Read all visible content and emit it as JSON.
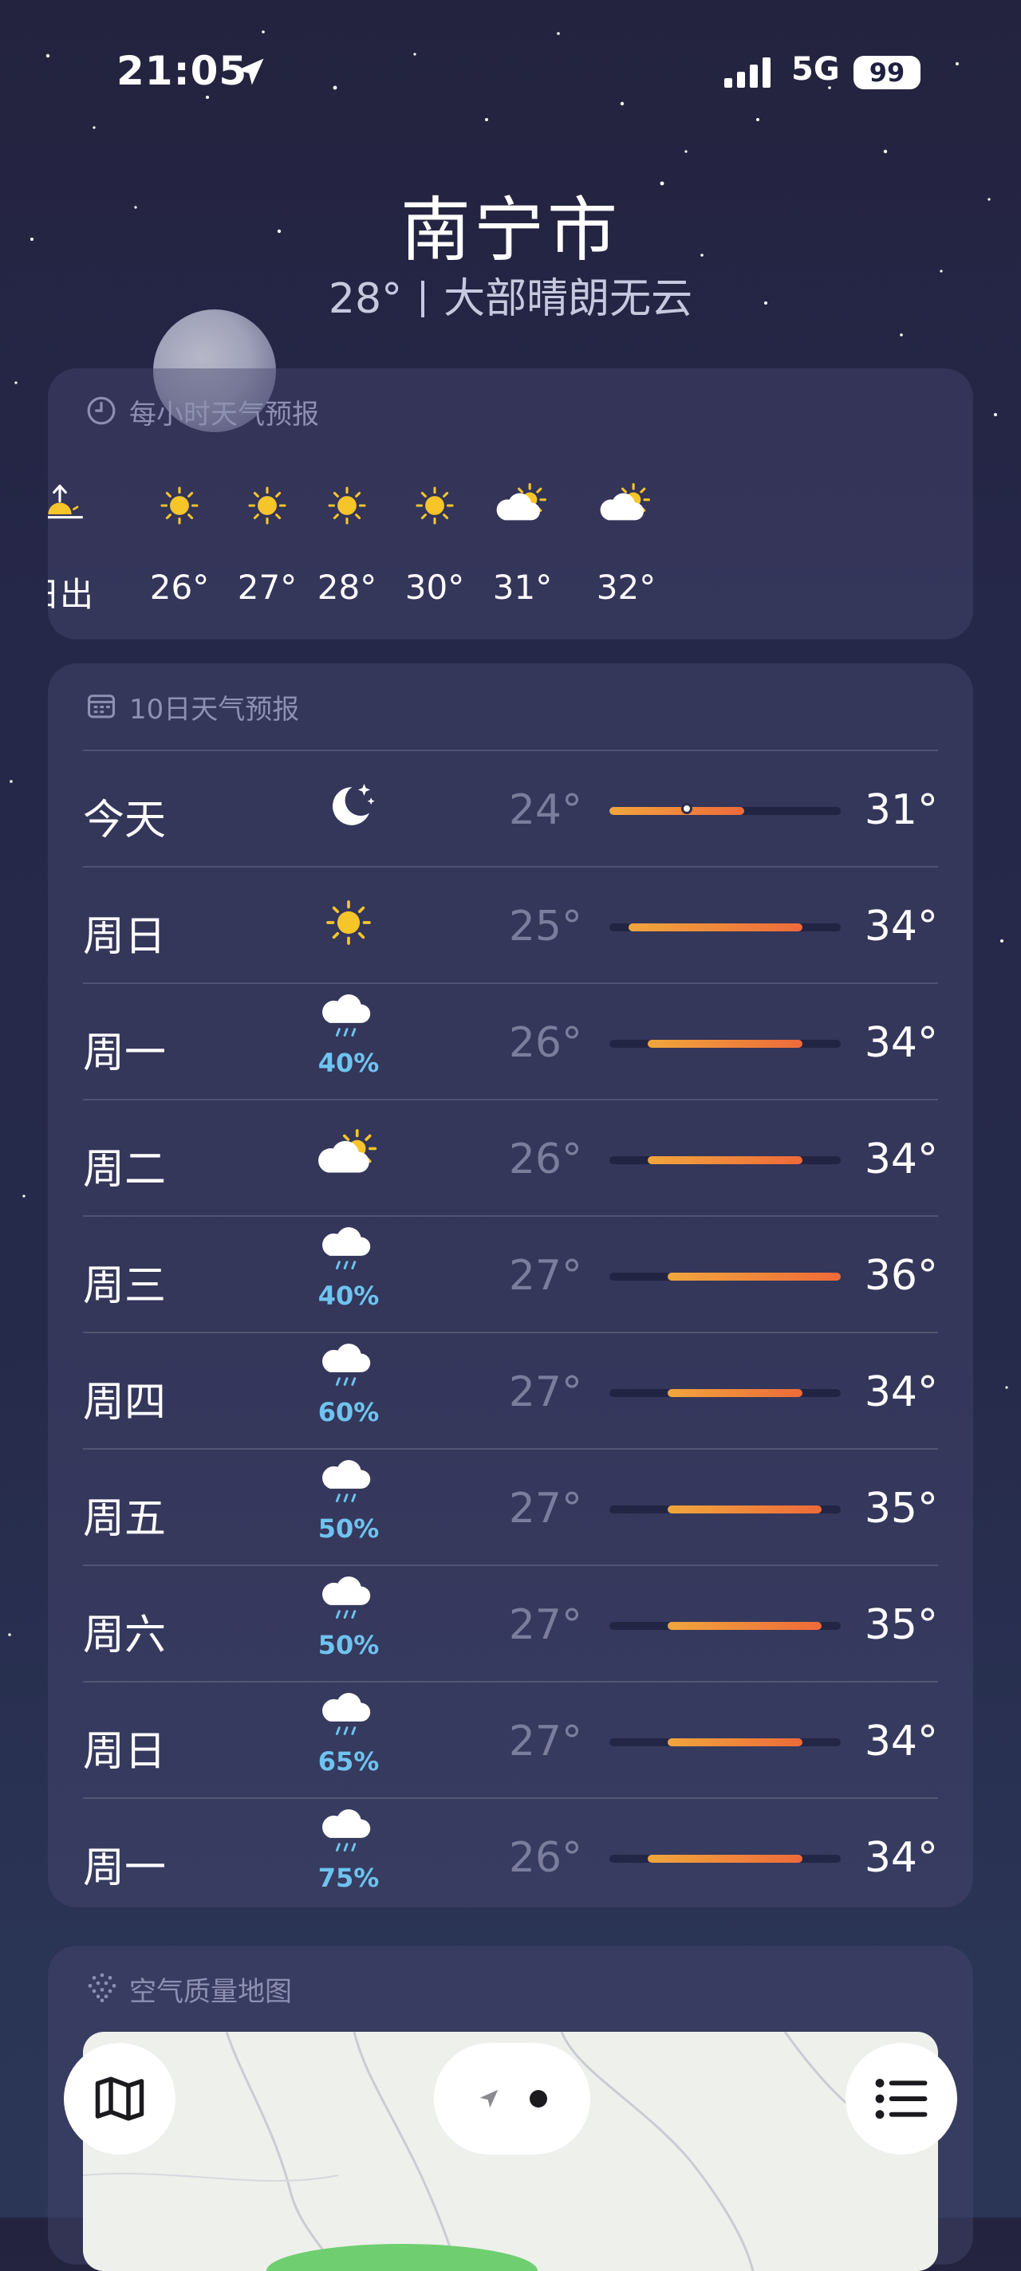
{
  "status_bar": {
    "time": "21:05",
    "network": "5G",
    "battery": "99"
  },
  "header": {
    "city": "南宁市",
    "temperature": "28°",
    "condition": "大部晴朗无云"
  },
  "hourly": {
    "title": "每小时天气预报",
    "items": [
      {
        "label": "日出",
        "icon": "sunrise-icon"
      },
      {
        "label": "26°",
        "icon": "sun-icon"
      },
      {
        "label": "27°",
        "icon": "sun-icon"
      },
      {
        "label": "28°",
        "icon": "sun-icon"
      },
      {
        "label": "30°",
        "icon": "sun-icon"
      },
      {
        "label": "31°",
        "icon": "partly-cloudy-icon"
      },
      {
        "label": "32°",
        "icon": "partly-cloudy-icon"
      }
    ]
  },
  "daily": {
    "title": "10日天气预报",
    "range_min": 24,
    "range_max": 36,
    "current_temp": 28,
    "rows": [
      {
        "day": "今天",
        "icon": "moon-stars-icon",
        "precip": "",
        "low": "24°",
        "high": "31°",
        "lo": 24,
        "hi": 31
      },
      {
        "day": "周日",
        "icon": "sun-icon",
        "precip": "",
        "low": "25°",
        "high": "34°",
        "lo": 25,
        "hi": 34
      },
      {
        "day": "周一",
        "icon": "rain-icon",
        "precip": "40%",
        "low": "26°",
        "high": "34°",
        "lo": 26,
        "hi": 34
      },
      {
        "day": "周二",
        "icon": "partly-cloudy-icon",
        "precip": "",
        "low": "26°",
        "high": "34°",
        "lo": 26,
        "hi": 34
      },
      {
        "day": "周三",
        "icon": "rain-icon",
        "precip": "40%",
        "low": "27°",
        "high": "36°",
        "lo": 27,
        "hi": 36
      },
      {
        "day": "周四",
        "icon": "rain-icon",
        "precip": "60%",
        "low": "27°",
        "high": "34°",
        "lo": 27,
        "hi": 34
      },
      {
        "day": "周五",
        "icon": "rain-icon",
        "precip": "50%",
        "low": "27°",
        "high": "35°",
        "lo": 27,
        "hi": 35
      },
      {
        "day": "周六",
        "icon": "rain-icon",
        "precip": "50%",
        "low": "27°",
        "high": "35°",
        "lo": 27,
        "hi": 35
      },
      {
        "day": "周日",
        "icon": "rain-icon",
        "precip": "65%",
        "low": "27°",
        "high": "34°",
        "lo": 27,
        "hi": 34
      },
      {
        "day": "周一",
        "icon": "rain-icon",
        "precip": "75%",
        "low": "26°",
        "high": "34°",
        "lo": 26,
        "hi": 34
      }
    ]
  },
  "air_quality": {
    "title": "空气质量地图"
  },
  "toolbar": {
    "map_icon": "map-icon",
    "location_icon": "location-arrow-icon",
    "list_icon": "list-icon"
  },
  "colors": {
    "accent_orange": "#ee6a3a",
    "accent_yellow": "#f0a63c",
    "precip_blue": "#6fc3ef"
  }
}
